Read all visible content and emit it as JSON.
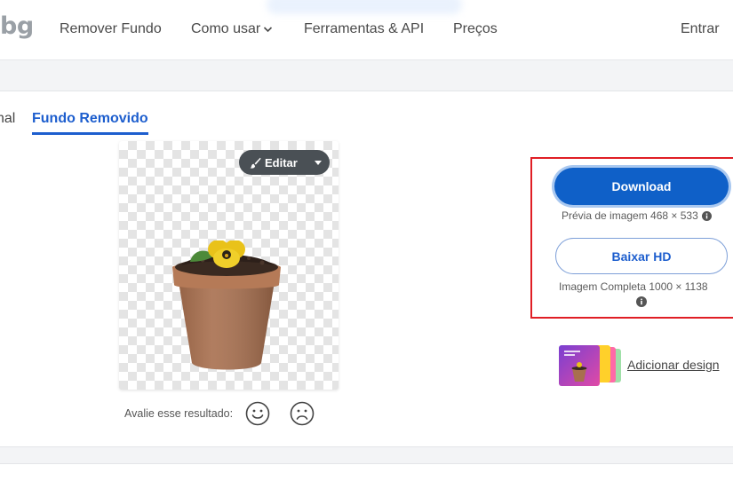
{
  "nav": {
    "logo": "bg",
    "links": [
      "Remover Fundo",
      "Como usar",
      "Ferramentas & API",
      "Preços"
    ],
    "login": "Entrar"
  },
  "tabs": {
    "original": "nal",
    "removed": "Fundo Removido"
  },
  "editor": {
    "edit_label": "Editar"
  },
  "rating": {
    "label": "Avalie esse resultado:",
    "icons": [
      "smile-face-icon",
      "sad-face-icon"
    ]
  },
  "download": {
    "download_label": "Download",
    "preview_info": "Prévia de imagem 468 × 533",
    "hd_label": "Baixar HD",
    "full_info": "Imagem Completa 1000 × 1138"
  },
  "design": {
    "link_label": "Adicionar design"
  },
  "colors": {
    "accent": "#0f60c8",
    "tab_active": "#1d5ece",
    "highlight": "#e01e25"
  }
}
